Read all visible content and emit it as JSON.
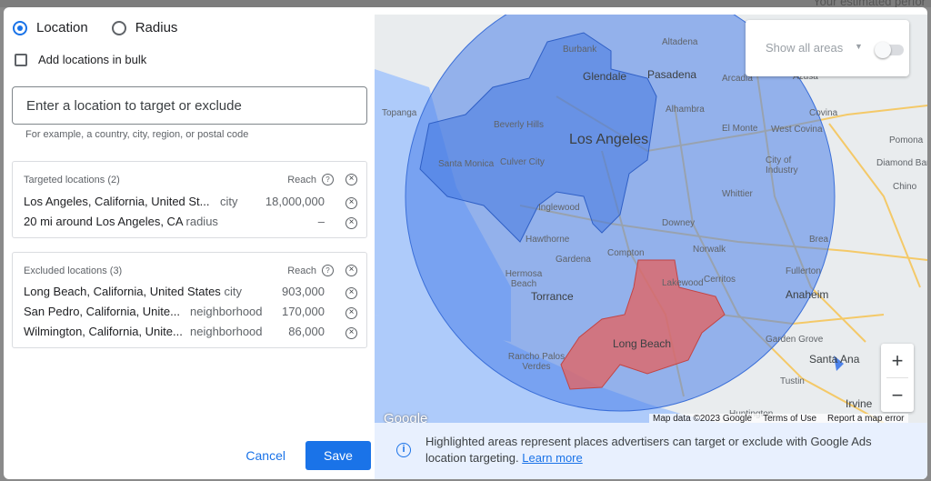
{
  "background_hint": "Your estimated perfor",
  "location_mode": {
    "location_label": "Location",
    "radius_label": "Radius",
    "selected": "Location"
  },
  "bulk": {
    "label": "Add locations in bulk",
    "checked": false
  },
  "search": {
    "placeholder": "Enter a location to target or exclude",
    "hint": "For example, a country, city, region, or postal code"
  },
  "targeted": {
    "heading": "Targeted locations (2)",
    "reach_label": "Reach",
    "rows": [
      {
        "name": "Los Angeles, California, United St...",
        "type": "city",
        "reach": "18,000,000"
      },
      {
        "name": "20 mi around Los Angeles, CA",
        "type": "radius",
        "reach": "–"
      }
    ]
  },
  "excluded": {
    "heading": "Excluded locations (3)",
    "reach_label": "Reach",
    "rows": [
      {
        "name": "Long Beach, California, United States",
        "type": "city",
        "reach": "903,000"
      },
      {
        "name": "San Pedro, California, Unite...",
        "type": "neighborhood",
        "reach": "170,000"
      },
      {
        "name": "Wilmington, California, Unite...",
        "type": "neighborhood",
        "reach": "86,000"
      }
    ]
  },
  "buttons": {
    "cancel": "Cancel",
    "save": "Save"
  },
  "map": {
    "show_all_label": "Show all areas",
    "show_all_on": false,
    "zoom_in": "+",
    "zoom_out": "−",
    "google_logo": "Google",
    "attribution": {
      "data": "Map data ©2023 Google",
      "terms": "Terms of Use",
      "report": "Report a map error"
    },
    "labels": {
      "burbank": "Burbank",
      "altadena": "Altadena",
      "glendale": "Glendale",
      "pasadena": "Pasadena",
      "arcadia": "Arcadia",
      "azusa": "Azusa",
      "topanga": "Topanga",
      "beverly_hills": "Beverly Hills",
      "los_angeles": "Los Angeles",
      "alhambra": "Alhambra",
      "el_monte": "El Monte",
      "west_covina": "West Covina",
      "covina": "Covina",
      "santa_monica": "Santa Monica",
      "culver_city": "Culver City",
      "city_of_industry": "City of Industry",
      "pomona": "Pomona",
      "diamond_bar": "Diamond Bar",
      "chino": "Chino",
      "inglewood": "Inglewood",
      "whittier": "Whittier",
      "downey": "Downey",
      "hawthorne": "Hawthorne",
      "compton": "Compton",
      "norwalk": "Norwalk",
      "brea": "Brea",
      "gardena": "Gardena",
      "hermosa_beach": "Hermosa Beach",
      "torrance": "Torrance",
      "lakewood": "Lakewood",
      "cerritos": "Cerritos",
      "fullerton": "Fullerton",
      "anaheim": "Anaheim",
      "long_beach": "Long Beach",
      "garden_grove": "Garden Grove",
      "rancho_palos_verdes": "Rancho Palos Verdes",
      "santa_ana": "Santa Ana",
      "tustin": "Tustin",
      "irvine": "Irvine",
      "huntington": "Huntington"
    }
  },
  "info": {
    "text": "Highlighted areas represent places advertisers can target or exclude with Google Ads location targeting.",
    "link": "Learn more"
  },
  "colors": {
    "accent": "#1a73e8",
    "target_fill": "#4c82ea",
    "exclude_fill": "#e06666"
  }
}
